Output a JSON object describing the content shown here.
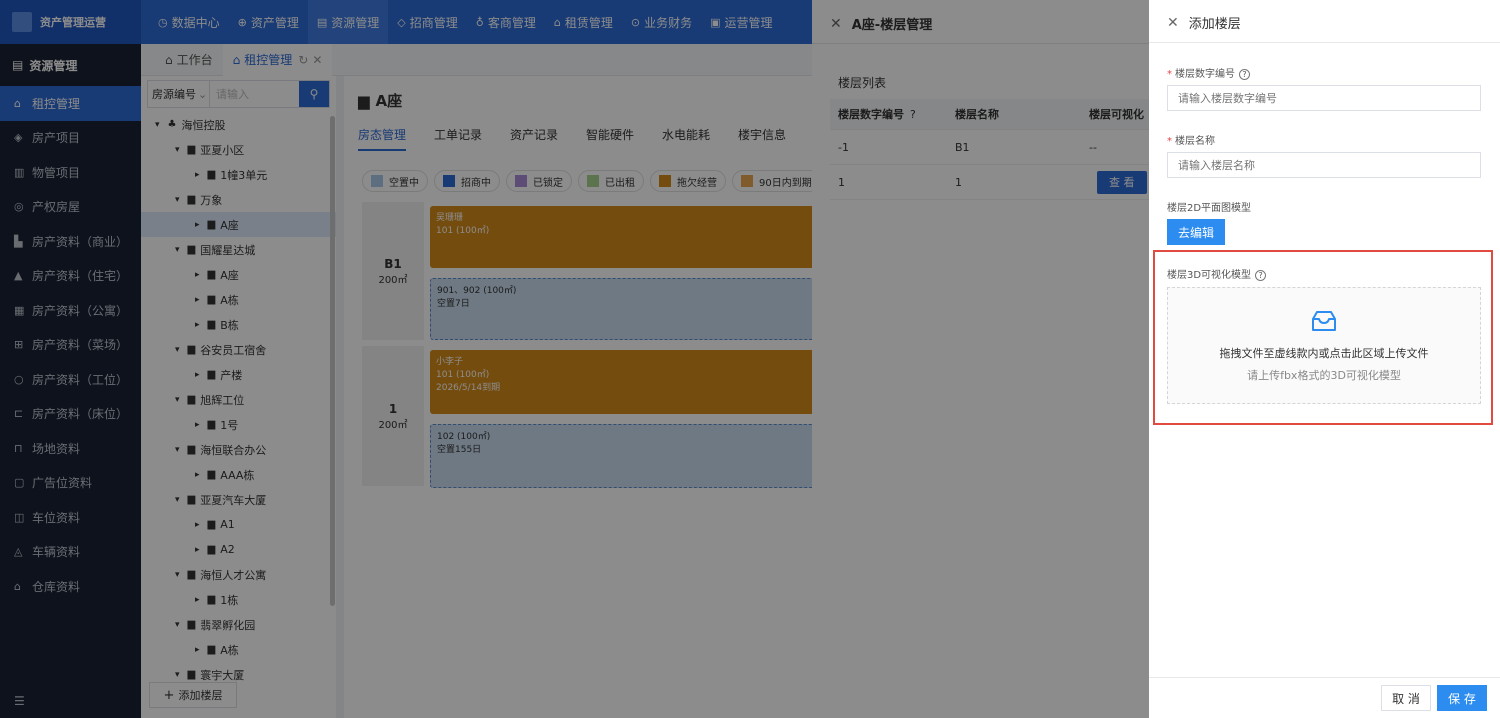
{
  "app": {
    "title": "资产管理运营"
  },
  "nav": [
    "数据中心",
    "资产管理",
    "资源管理",
    "招商管理",
    "客商管理",
    "租赁管理",
    "业务财务",
    "运营管理"
  ],
  "sidebar": {
    "header": "资源管理",
    "items": [
      "租控管理",
      "房产项目",
      "物管项目",
      "产权房屋",
      "房产资料（商业）",
      "房产资料（住宅）",
      "房产资料（公寓）",
      "房产资料（菜场）",
      "房产资料（工位）",
      "房产资料（床位）",
      "场地资料",
      "广告位资料",
      "车位资料",
      "车辆资料",
      "仓库资料"
    ]
  },
  "tabs": [
    "工作台",
    "租控管理"
  ],
  "tree": {
    "search_select": "房源编号",
    "search_placeholder": "请输入",
    "nodes": [
      "海恒控股",
      "亚夏小区",
      "1幢3单元",
      "万象",
      "A座",
      "国耀星达城",
      "A座",
      "A栋",
      "B栋",
      "谷安员工宿舍",
      "产楼",
      "旭辉工位",
      "1号",
      "海恒联合办公",
      "AAA栋",
      "亚夏汽车大厦",
      "A1",
      "A2",
      "海恒人才公寓",
      "1栋",
      "翡翠孵化园",
      "A栋",
      "寰宇大厦"
    ],
    "add_button": "添加楼层"
  },
  "main": {
    "title": "A座",
    "subtabs": [
      "房态管理",
      "工单记录",
      "资产记录",
      "智能硬件",
      "水电能耗",
      "楼宇信息"
    ],
    "legend": [
      {
        "label": "空置中",
        "color": "#a9c8ec"
      },
      {
        "label": "招商中",
        "color": "#2d6ad6"
      },
      {
        "label": "已锁定",
        "color": "#a98ad6"
      },
      {
        "label": "已出租",
        "color": "#a6d38c"
      },
      {
        "label": "拖欠经营",
        "color": "#d38a1a"
      },
      {
        "label": "90日内到期",
        "color": "#e9a750"
      }
    ],
    "floors": [
      {
        "name": "B1",
        "area": "200㎡"
      },
      {
        "name": "1",
        "area": "200㎡"
      }
    ],
    "rooms": [
      {
        "l1": "吴珊珊",
        "l2": "101 (100㎡)",
        "l3": ""
      },
      {
        "l1": "901、902 (100㎡)",
        "l2": "空置7日",
        "l3": ""
      },
      {
        "l1": "小李子",
        "l2": "101 (100㎡)",
        "l3": "2026/5/14到期"
      },
      {
        "l1": "102 (100㎡)",
        "l2": "空置155日",
        "l3": ""
      }
    ]
  },
  "mid_panel": {
    "title": "A座-楼层管理",
    "list_title": "楼层列表",
    "columns": [
      "楼层数字编号",
      "楼层名称",
      "楼层可视化"
    ],
    "rows": [
      {
        "num": "-1",
        "name": "B1",
        "vis": "--"
      },
      {
        "num": "1",
        "name": "1",
        "vis": ""
      }
    ],
    "view_button": "查 看"
  },
  "drawer": {
    "title": "添加楼层",
    "floor_num_label": "楼层数字编号",
    "floor_num_placeholder": "请输入楼层数字编号",
    "floor_name_label": "楼层名称",
    "floor_name_placeholder": "请输入楼层名称",
    "model2d_label": "楼层2D平面图模型",
    "edit_button": "去编辑",
    "model3d_label": "楼层3D可视化模型",
    "upload_main": "拖拽文件至虚线款内或点击此区域上传文件",
    "upload_hint": "请上传fbx格式的3D可视化模型",
    "cancel": "取 消",
    "save": "保 存"
  }
}
